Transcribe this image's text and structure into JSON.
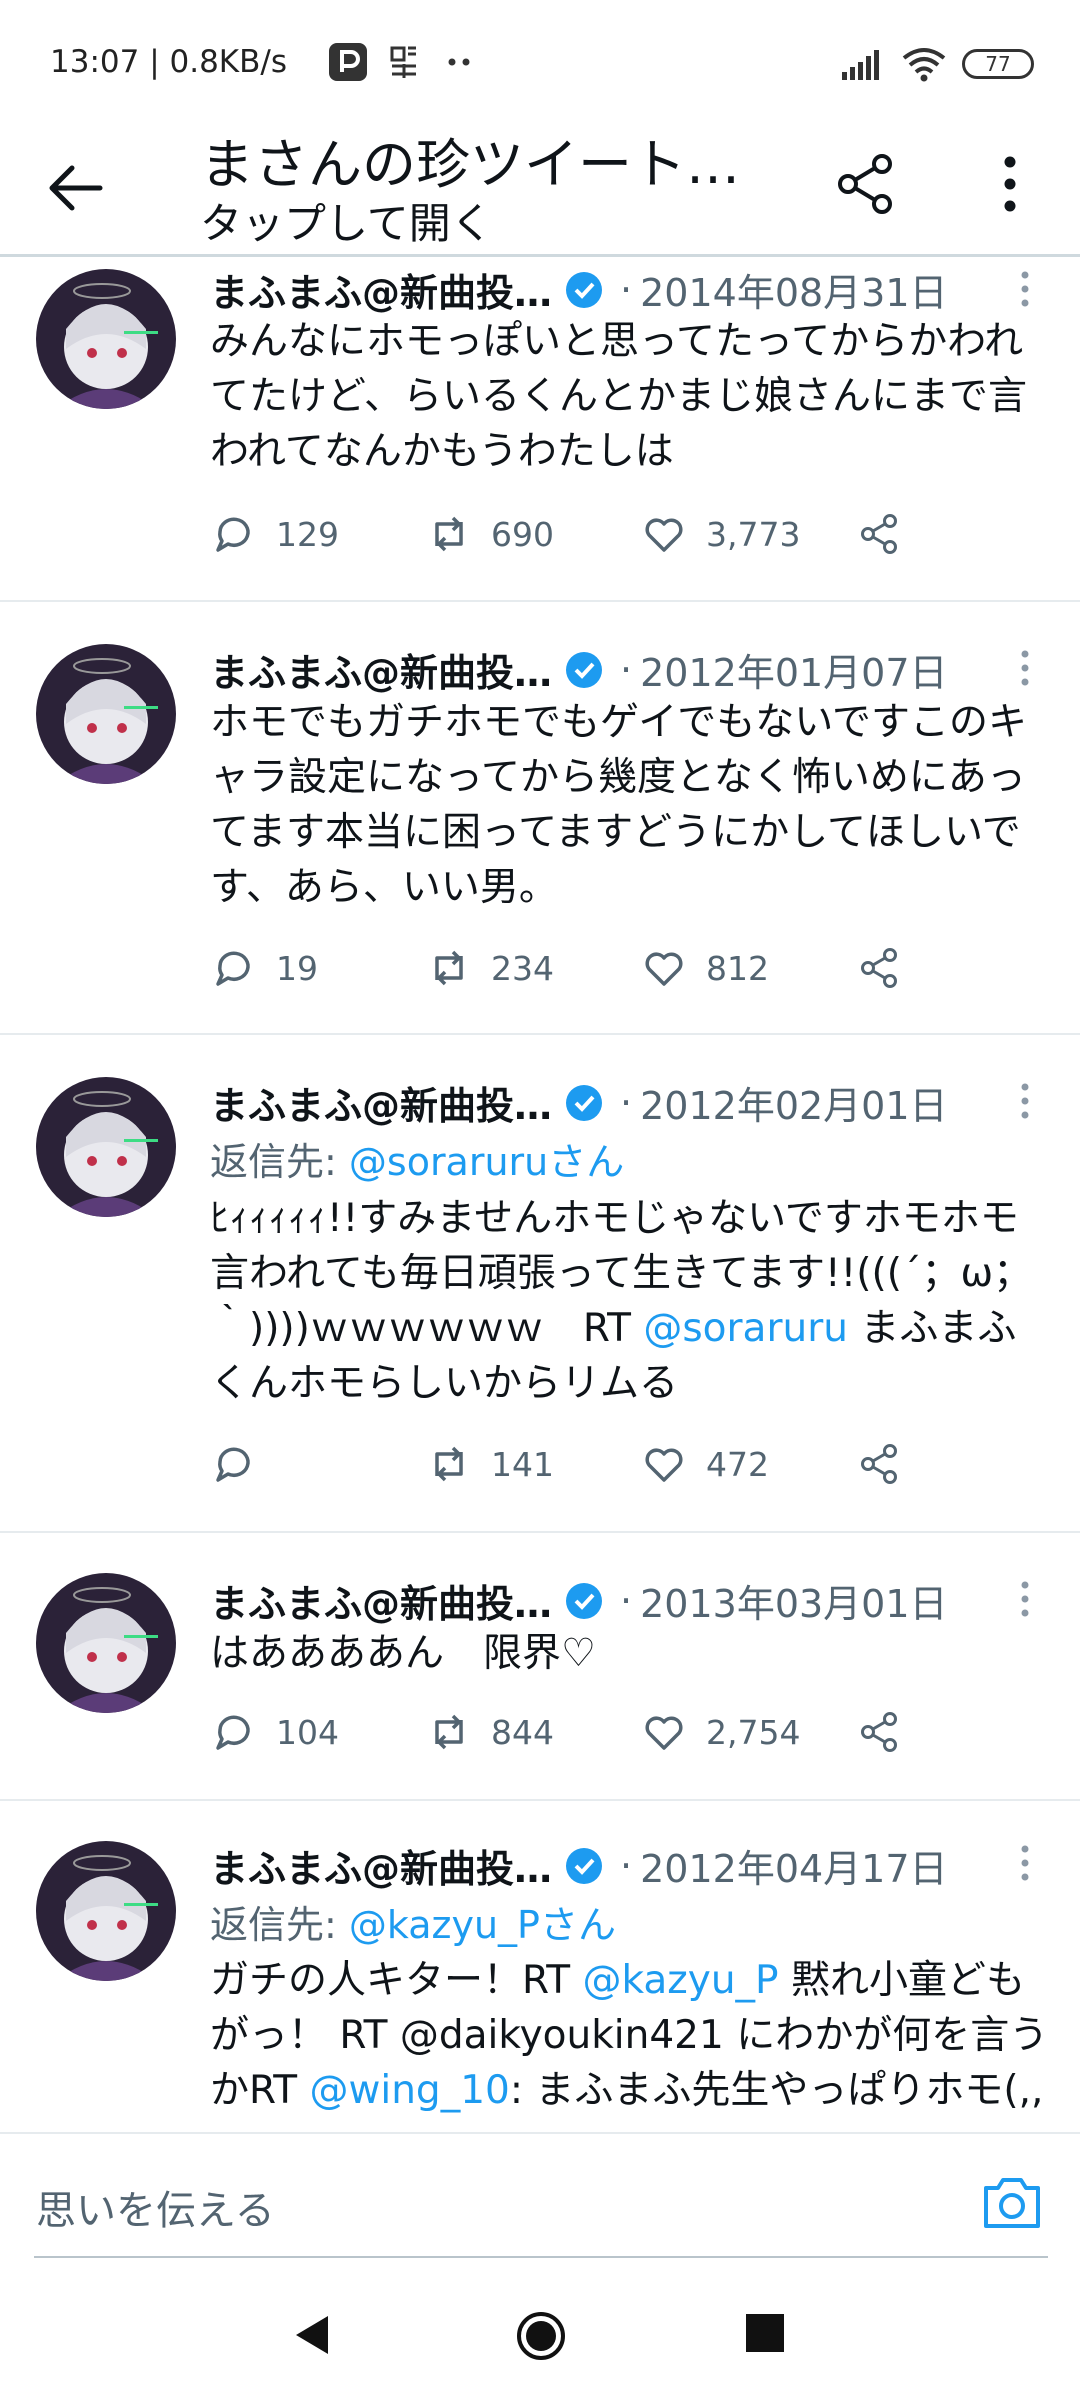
{
  "status_bar": {
    "time_speed": "13:07 | 0.8KB/s",
    "battery": "77"
  },
  "header": {
    "title": "まさんの珍ツイート…",
    "subtitle": "タップして開く"
  },
  "tweets": [
    {
      "name": "まふまふ@新曲投…",
      "date": "2014年08月31日",
      "reply_to": null,
      "text": "みんなにホモっぽいと思ってたってからかわれてたけど、らいるくんとかまじ娘さんにまで言われてなんかもうわたしは",
      "replies": "129",
      "retweets": "690",
      "likes": "3,773"
    },
    {
      "name": "まふまふ@新曲投…",
      "date": "2012年01月07日",
      "reply_to": null,
      "text": "ホモでもガチホモでもゲイでもないですこのキャラ設定になってから幾度となく怖いめにあってます本当に困ってますどうにかしてほしいです、あら、いい男。",
      "replies": "19",
      "retweets": "234",
      "likes": "812"
    },
    {
      "name": "まふまふ@新曲投…",
      "date": "2012年02月01日",
      "reply_to_prefix": "返信先: ",
      "reply_to": "@soraruruさん",
      "text_parts": [
        "ﾋｨｨｨｨｨ!!すみませんホモじゃないですホモホモ言われても毎日頑張って生きてます!!(((´；ω；｀))))ｗｗｗｗｗｗ　RT ",
        "@soraruru",
        " まふまふくんホモらしいからリムる"
      ],
      "replies": "",
      "retweets": "141",
      "likes": "472"
    },
    {
      "name": "まふまふ@新曲投…",
      "date": "2013年03月01日",
      "reply_to": null,
      "text": "はああああん　限界♡",
      "replies": "104",
      "retweets": "844",
      "likes": "2,754"
    },
    {
      "name": "まふまふ@新曲投…",
      "date": "2012年04月17日",
      "reply_to_prefix": "返信先: ",
      "reply_to": "@kazyu_Pさん",
      "text_parts": [
        "ガチの人キター！RT ",
        "@kazyu_P",
        " 黙れ小童どもがっ！ RT @daikyoukin421 にわかが何を言うかRT ",
        "@wing_10",
        ": まふまふ先生やっぱりホモ(,,"
      ]
    }
  ],
  "dot_separator": "·",
  "composer": {
    "placeholder": "思いを伝える"
  },
  "colors": {
    "accent": "#1d9bf0",
    "muted": "#536471",
    "text": "#0f1419"
  }
}
